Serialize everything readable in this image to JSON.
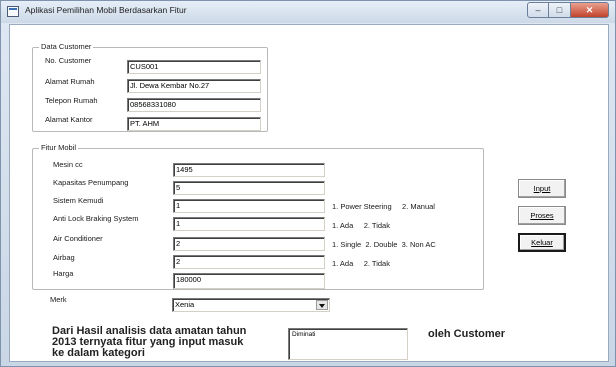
{
  "window": {
    "title": "Aplikasi Pemilihan Mobil Berdasarkan Fitur"
  },
  "customer_frame": {
    "title": "Data Customer",
    "fields": [
      {
        "label": "No. Customer",
        "value": "CUS001"
      },
      {
        "label": "Alamat Rumah",
        "value": "Jl. Dewa Kembar No.27"
      },
      {
        "label": "Telepon Rumah",
        "value": "08568331080"
      },
      {
        "label": "Alamat Kantor",
        "value": "PT. AHM"
      }
    ]
  },
  "fitur_frame": {
    "title": "Fitur Mobil",
    "fields": [
      {
        "label": "Mesin cc",
        "value": "1495",
        "hint": ""
      },
      {
        "label": "Kapasitas Penumpang",
        "value": "5",
        "hint": ""
      },
      {
        "label": "Sistem Kemudi",
        "value": "1",
        "hint": "1. Power Steering     2. Manual"
      },
      {
        "label": "Anti Lock Braking System",
        "value": "1",
        "hint": "1. Ada     2. Tidak"
      },
      {
        "label": "Air Conditioner",
        "value": "2",
        "hint": "1. Single  2. Double  3. Non AC"
      },
      {
        "label": "Airbag",
        "value": "2",
        "hint": "1. Ada     2. Tidak"
      },
      {
        "label": "Harga",
        "value": "180000",
        "hint": ""
      }
    ]
  },
  "merk": {
    "label": "Merk",
    "selected": "Xenia"
  },
  "buttons": {
    "input": "Input",
    "proses": "Proses",
    "keluar": "Keluar"
  },
  "conclusion": {
    "text": "Dari Hasil analisis data amatan tahun\n2013 ternyata fitur yang input masuk\nke dalam kategori",
    "result": "Diminati",
    "suffix": "oleh Customer"
  }
}
